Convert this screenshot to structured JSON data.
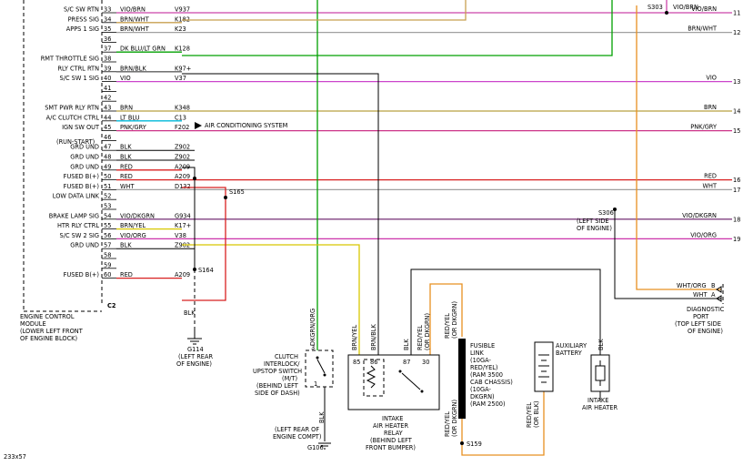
{
  "colors": {
    "violet_brown": "#cc44aa",
    "brown_white": "#c8a050",
    "dkblu_ltgrn": "#00a000",
    "brown_black": "#606060",
    "violet": "#cc44cc",
    "brown": "#b8a040",
    "ltblu": "#00b8d8",
    "pnk_gry": "#cc3388",
    "red": "#d82020",
    "white": "#a0a0a0",
    "vio_dkgrn": "#804080",
    "brn_yel": "#d8c800",
    "vio_org": "#cc33aa",
    "orange": "#e89020",
    "dkgrn_org": "#00a000"
  },
  "ecm": {
    "label_lines": [
      "ENGINE CONTROL",
      "MODULE",
      "(LOWER LEFT FRONT",
      "OF ENGINE BLOCK)"
    ],
    "connector_label": "C2"
  },
  "pins": [
    {
      "num": "33",
      "name": "S/C SW RTN",
      "color": "VIO/BRN",
      "circuit": "V937",
      "right_color": "VIO/BRN",
      "right_num": "11",
      "wire": "violet_brown"
    },
    {
      "num": "34",
      "name": "PRESS SIG",
      "color": "BRN/WHT",
      "circuit": "K182",
      "right_color": "",
      "right_num": "",
      "wire": "brown_white"
    },
    {
      "num": "35",
      "name": "APPS 1 SIG",
      "color": "BRN/WHT",
      "circuit": "K23",
      "right_color": "BRN/WHT",
      "right_num": "12",
      "wire": "white"
    },
    {
      "num": "36",
      "name": "",
      "color": "",
      "circuit": "",
      "right_color": "",
      "right_num": "",
      "wire": ""
    },
    {
      "num": "37",
      "name": "",
      "color": "DK BLU/LT GRN",
      "circuit": "K128",
      "right_color": "",
      "right_num": "",
      "wire": "dkblu_ltgrn"
    },
    {
      "num": "38",
      "name": "RMT THROTTLE SIG",
      "color": "",
      "circuit": "",
      "right_color": "",
      "right_num": "",
      "wire": ""
    },
    {
      "num": "39",
      "name": "RLY CTRL RTN",
      "color": "BRN/BLK",
      "circuit": "K97+",
      "right_color": "",
      "right_num": "",
      "wire": "brown_black"
    },
    {
      "num": "40",
      "name": "S/C SW 1 SIG",
      "color": "VIO",
      "circuit": "V37",
      "right_color": "VIO",
      "right_num": "13",
      "wire": "violet"
    },
    {
      "num": "41",
      "name": "",
      "color": "",
      "circuit": "",
      "right_color": "",
      "right_num": "",
      "wire": ""
    },
    {
      "num": "42",
      "name": "",
      "color": "",
      "circuit": "",
      "right_color": "",
      "right_num": "",
      "wire": ""
    },
    {
      "num": "43",
      "name": "SMT PWR RLY RTN",
      "color": "BRN",
      "circuit": "K348",
      "right_color": "BRN",
      "right_num": "14",
      "wire": "brown"
    },
    {
      "num": "44",
      "name": "A/C CLUTCH CTRL",
      "color": "LT BLU",
      "circuit": "C13",
      "right_color": "",
      "right_num": "",
      "wire": "ltblu"
    },
    {
      "num": "45",
      "name": "IGN SW OUT",
      "color": "PNK/GRY",
      "circuit": "F202",
      "right_color": "PNK/GRY",
      "right_num": "15",
      "wire": "pnk_gry"
    },
    {
      "num": "46",
      "name": "",
      "color": "",
      "circuit": "",
      "right_color": "",
      "right_num": "",
      "wire": ""
    },
    {
      "num": "47",
      "name": "GRD UND",
      "color": "BLK",
      "circuit": "Z902",
      "right_color": "",
      "right_num": "",
      "wire": ""
    },
    {
      "num": "48",
      "name": "GRD UND",
      "color": "BLK",
      "circuit": "Z902",
      "right_color": "",
      "right_num": "",
      "wire": ""
    },
    {
      "num": "49",
      "name": "GRD UND",
      "color": "RED",
      "circuit": "A209",
      "right_color": "",
      "right_num": "",
      "wire": "red"
    },
    {
      "num": "50",
      "name": "FUSED B(+)",
      "color": "RED",
      "circuit": "A209",
      "right_color": "RED",
      "right_num": "16",
      "wire": "red"
    },
    {
      "num": "51",
      "name": "FUSED B(+)",
      "color": "WHT",
      "circuit": "D132",
      "right_color": "WHT",
      "right_num": "17",
      "wire": "white"
    },
    {
      "num": "52",
      "name": "LOW DATA LINK",
      "color": "",
      "circuit": "",
      "right_color": "",
      "right_num": "",
      "wire": ""
    },
    {
      "num": "53",
      "name": "",
      "color": "",
      "circuit": "",
      "right_color": "",
      "right_num": "",
      "wire": ""
    },
    {
      "num": "54",
      "name": "BRAKE LAMP SIG",
      "color": "VIO/DKGRN",
      "circuit": "G934",
      "right_color": "VIO/DKGRN",
      "right_num": "18",
      "wire": "vio_dkgrn"
    },
    {
      "num": "55",
      "name": "HTR RLY CTRL",
      "color": "BRN/YEL",
      "circuit": "K17+",
      "right_color": "",
      "right_num": "",
      "wire": "brn_yel"
    },
    {
      "num": "56",
      "name": "S/C SW 2 SIG",
      "color": "VIO/ORG",
      "circuit": "V38",
      "right_color": "VIO/ORG",
      "right_num": "19",
      "wire": "vio_org"
    },
    {
      "num": "57",
      "name": "GRD UND",
      "color": "BLK",
      "circuit": "Z902",
      "right_color": "",
      "right_num": "",
      "wire": ""
    },
    {
      "num": "58",
      "name": "",
      "color": "",
      "circuit": "",
      "right_color": "",
      "right_num": "",
      "wire": ""
    },
    {
      "num": "59",
      "name": "",
      "color": "",
      "circuit": "",
      "right_color": "",
      "right_num": "",
      "wire": ""
    },
    {
      "num": "60",
      "name": "FUSED B(+)",
      "color": "RED",
      "circuit": "A209",
      "right_color": "",
      "right_num": "",
      "wire": "red"
    }
  ],
  "labels": {
    "ac_system": "AIR CONDITIONING SYSTEM",
    "ign_sub": "(RUN-START)",
    "s165": "S165",
    "s164": "S164",
    "s303": "S303",
    "s306": "S306",
    "s306_desc": [
      "(LEFT SIDE",
      "OF ENGINE)"
    ],
    "g114": "G114",
    "g114_desc": [
      "(LEFT REAR",
      "OF ENGINE)"
    ],
    "blk": "BLK",
    "clutch_lines": [
      "CLUTCH",
      "INTERLOCK/",
      "UPSTOP SWITCH",
      "(M/T)",
      "(BEHIND LEFT",
      "SIDE OF DASH)"
    ],
    "g106_desc": [
      "(LEFT REAR OF",
      "ENGINE COMPT)"
    ],
    "g106": "G106",
    "dkgrn_org": "DKGRN/ORG",
    "brn_yel": "BRN/YEL",
    "brn_blk": "BRN/BLK",
    "red_yel_1": "RED/YEL",
    "or_dkgrn_1": "(OR DKGRN)",
    "relay_lines": [
      "INTAKE",
      "AIR HEATER",
      "RELAY",
      "(BEHIND LEFT",
      "FRONT BUMPER)"
    ],
    "relay_pins": [
      "85",
      "86",
      "87",
      "30"
    ],
    "fusible_lines": [
      "FUSIBLE",
      "LINK",
      "(10GA-",
      "RED/YEL)",
      "(RAM 3500",
      "CAB CHASSIS)",
      "(10GA-",
      "DKGRN)",
      "(RAM 2500)"
    ],
    "red_yel_2": "RED/YEL",
    "or_dkgrn_2": "(OR DKGRN)",
    "s159": "S159",
    "battery_lines": [
      "AUXILIARY",
      "BATTERY"
    ],
    "red_yel_3": "RED/YEL",
    "or_blk": "(OR BLK)",
    "heater_lines": [
      "INTAKE",
      "AIR HEATER"
    ],
    "diag_lines": [
      "DIAGNOSTIC",
      "PORT",
      "(TOP LEFT SIDE",
      "OF ENGINE)"
    ],
    "wht_org": "WHT/ORG",
    "wht": "WHT",
    "pin_b": "B",
    "pin_a": "A",
    "vio_brn_top": "VIO/BRN",
    "fig_id": "233x57"
  }
}
